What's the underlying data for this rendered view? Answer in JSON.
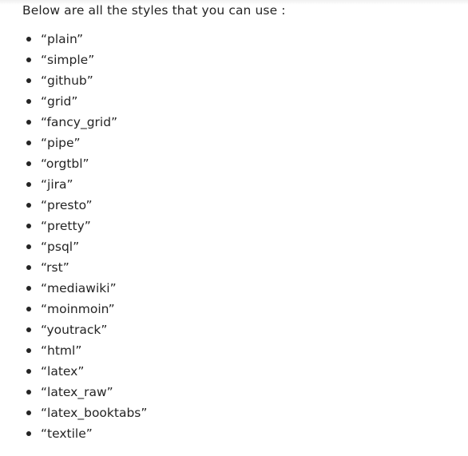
{
  "intro": "Below are all the styles that you can use :",
  "styles": [
    "“plain”",
    "“simple”",
    "“github”",
    "“grid”",
    "“fancy_grid”",
    "“pipe”",
    "“orgtbl”",
    "“jira”",
    "“presto”",
    "“pretty”",
    "“psql”",
    "“rst”",
    "“mediawiki”",
    "“moinmoin”",
    "“youtrack”",
    "“html”",
    "“latex”",
    "“latex_raw”",
    "“latex_booktabs”",
    "“textile”"
  ]
}
